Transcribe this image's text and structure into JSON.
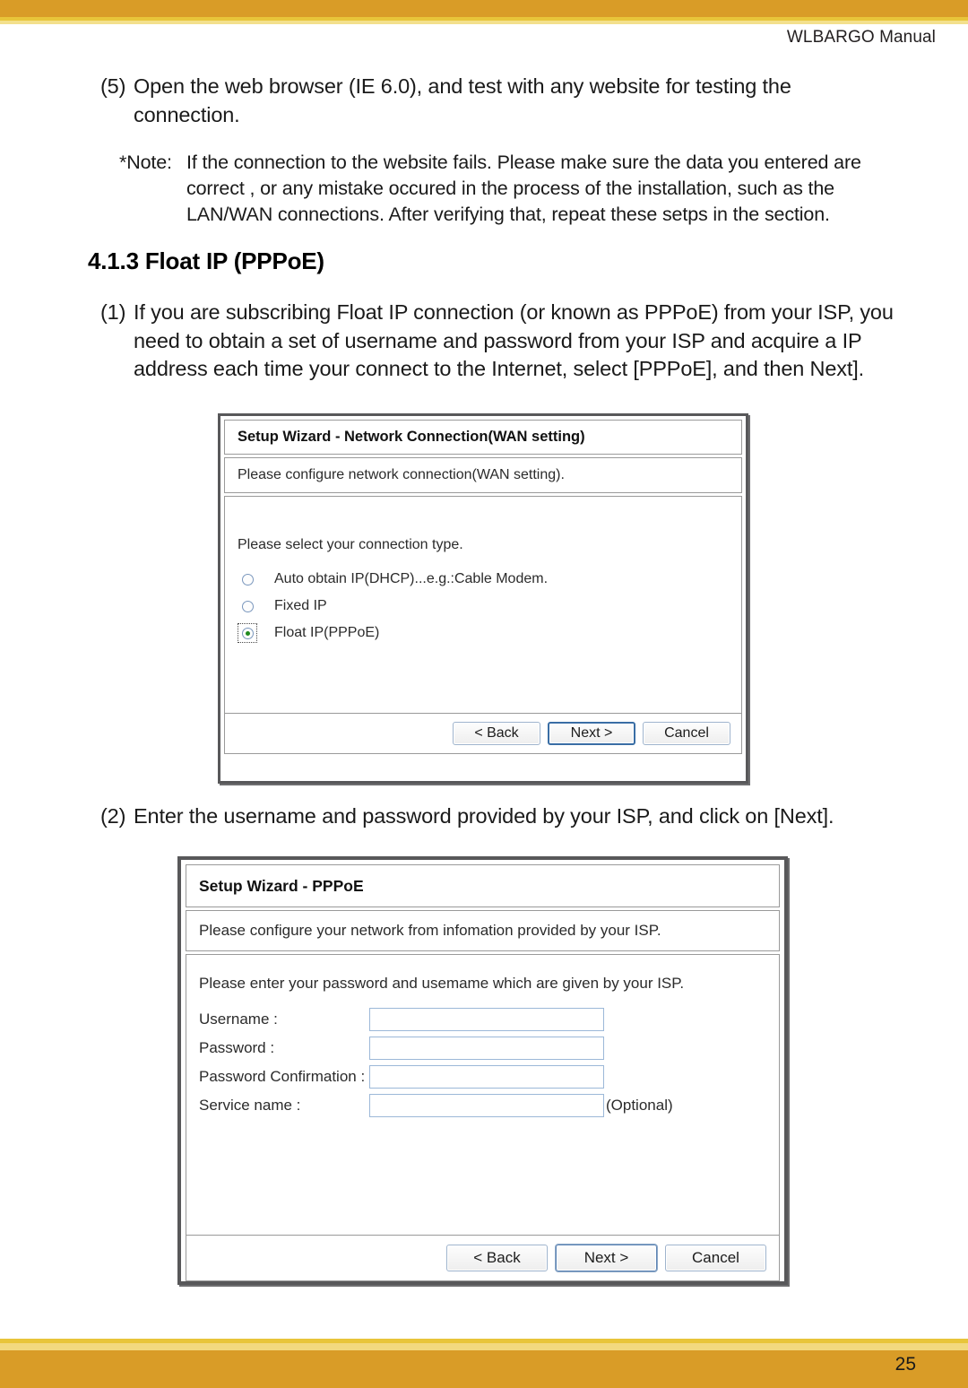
{
  "page": {
    "running_head": "WLBARGO Manual",
    "page_number": "25",
    "accent_orange": "#d99c27",
    "accent_gold": "#e8c53a",
    "accent_cream": "#f2d97f"
  },
  "body": {
    "step5": {
      "marker": "(5)",
      "text": "Open the web browser (IE 6.0), and test with any website for testing the connection."
    },
    "note": {
      "marker": "*Note:",
      "text": "If the connection to the website fails. Please make sure the data you entered are correct , or any mistake occured in the process of the installation, such as the LAN/WAN connections. After verifying that, repeat these setps in the section."
    },
    "section_heading": "4.1.3 Float IP (PPPoE)",
    "step1": {
      "marker": "(1)",
      "text": "If you are subscribing Float IP connection (or known as PPPoE) from your ISP, you need to obtain a set of username and password from your ISP and acquire a IP address each time your connect to the Internet, select [PPPoE], and then Next]."
    },
    "step2": {
      "marker": "(2)",
      "text": "Enter the username and password provided by your ISP, and click on [Next]."
    }
  },
  "dialog_wan": {
    "title": "Setup Wizard - Network Connection(WAN setting)",
    "subtitle": "Please configure network connection(WAN setting).",
    "prompt": "Please select your connection type.",
    "options": [
      {
        "label": "Auto obtain IP(DHCP)...e.g.:Cable Modem.",
        "selected": false,
        "focused": false
      },
      {
        "label": "Fixed IP",
        "selected": false,
        "focused": false
      },
      {
        "label": "Float IP(PPPoE)",
        "selected": true,
        "focused": true
      }
    ],
    "buttons": {
      "back": "< Back",
      "next": "Next >",
      "cancel": "Cancel"
    }
  },
  "dialog_pppoe": {
    "title": "Setup Wizard - PPPoE",
    "subtitle": "Please configure your network from infomation provided by your ISP.",
    "prompt": "Please enter your password and usemame which are given by your ISP.",
    "fields": [
      {
        "label": "Username :",
        "value": "",
        "suffix": ""
      },
      {
        "label": "Password :",
        "value": "",
        "suffix": ""
      },
      {
        "label": "Password Confirmation :",
        "value": "",
        "suffix": ""
      },
      {
        "label": "Service name :",
        "value": "",
        "suffix": "(Optional)"
      }
    ],
    "buttons": {
      "back": "< Back",
      "next": "Next >",
      "cancel": "Cancel"
    }
  }
}
